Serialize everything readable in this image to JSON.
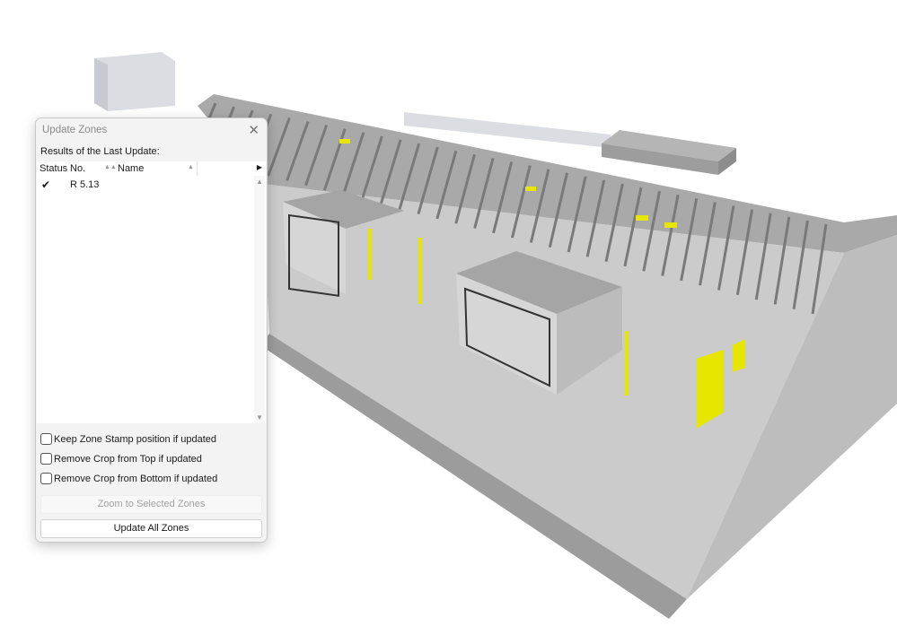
{
  "dialog": {
    "title": "Update Zones",
    "results_label": "Results of the Last Update:",
    "columns": [
      "Status",
      "No.",
      "Name"
    ],
    "rows": [
      {
        "status": "✔",
        "no": "R 5.13",
        "name": ""
      }
    ],
    "options": [
      {
        "label": "Keep Zone Stamp position if updated",
        "checked": false
      },
      {
        "label": "Remove Crop from Top if updated",
        "checked": false
      },
      {
        "label": "Remove Crop from Bottom if updated",
        "checked": false
      }
    ],
    "zoom_button": "Zoom to Selected Zones",
    "update_button": "Update All Zones"
  },
  "colors": {
    "highlight": "#e6e600",
    "model": "#c8c8c8"
  }
}
